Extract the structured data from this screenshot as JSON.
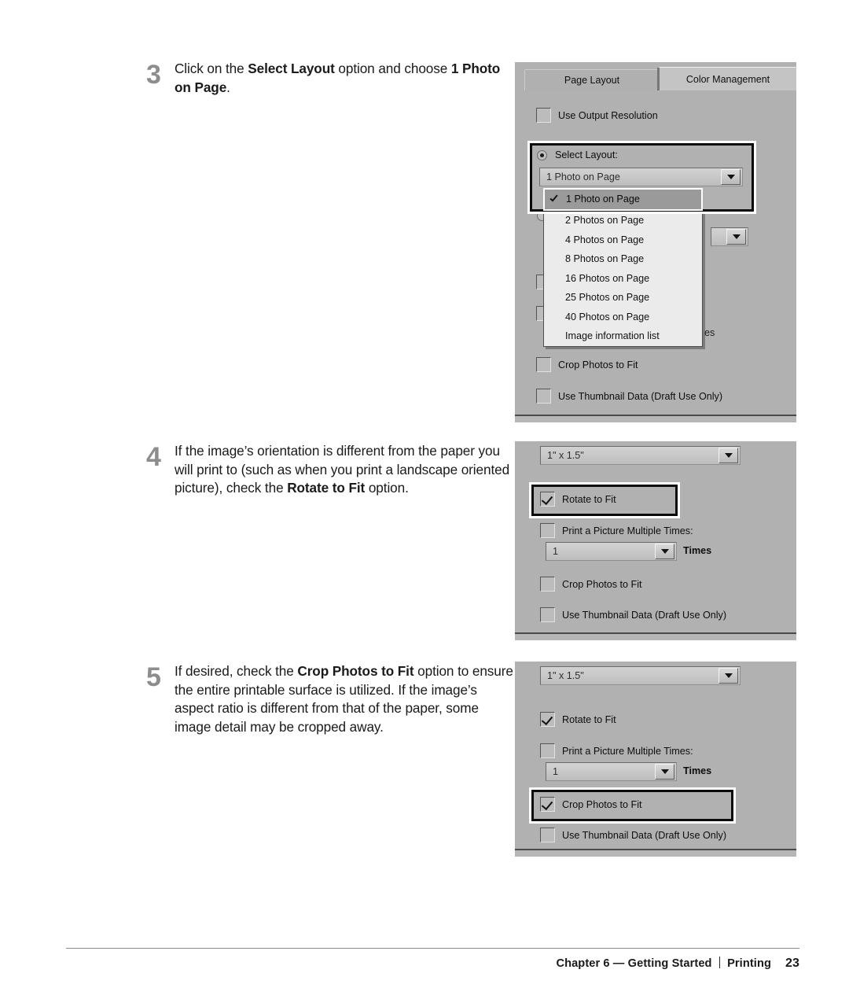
{
  "steps": [
    {
      "number": "3",
      "text_parts": [
        {
          "t": "Click on the ",
          "b": false
        },
        {
          "t": "Select Layout",
          "b": true
        },
        {
          "t": " option and choose ",
          "b": false
        },
        {
          "t": "1 Photo on Page",
          "b": true
        },
        {
          "t": ".",
          "b": false
        }
      ]
    },
    {
      "number": "4",
      "text_parts": [
        {
          "t": "If the image’s orientation is different from the paper you will print to (such as when you print a landscape oriented picture), check the ",
          "b": false
        },
        {
          "t": "Rotate to Fit",
          "b": true
        },
        {
          "t": " option.",
          "b": false
        }
      ]
    },
    {
      "number": "5",
      "text_parts": [
        {
          "t": "If desired, check the ",
          "b": false
        },
        {
          "t": "Crop Photos to Fit",
          "b": true
        },
        {
          "t": " option to ensure the entire printable surface is utilized. If the image’s aspect ratio is different from that of the paper, some image detail may be cropped away.",
          "b": false
        }
      ]
    }
  ],
  "panel1": {
    "tabs": [
      {
        "label": "Page Layout",
        "active": false
      },
      {
        "label": "Color Management",
        "active": true
      }
    ],
    "use_output_resolution": {
      "label": "Use Output Resolution",
      "checked": false
    },
    "select_layout": {
      "label": "Select Layout:",
      "selected": true
    },
    "layout_combo_value": "1 Photo on Page",
    "dropdown_items": [
      "1 Photo on Page",
      "2 Photos on Page",
      "4 Photos on Page",
      "8 Photos on Page",
      "16 Photos on Page",
      "25 Photos on Page",
      "40 Photos on Page",
      "Image information list"
    ],
    "dropdown_selected_index": 0,
    "times_label_fragment": "es",
    "crop_photos_to_fit": {
      "label": "Crop Photos to Fit",
      "checked": false
    },
    "use_thumbnail_data": {
      "label": "Use Thumbnail Data (Draft Use Only)",
      "checked": false
    }
  },
  "panel2": {
    "size_combo_value": "1\" x 1.5\"",
    "rotate_to_fit": {
      "label": "Rotate to Fit",
      "checked": true,
      "highlighted": true
    },
    "print_multiple": {
      "label": "Print a Picture Multiple Times:",
      "checked": false
    },
    "times_combo_value": "1",
    "times_label": "Times",
    "crop_photos_to_fit": {
      "label": "Crop Photos to Fit",
      "checked": false,
      "highlighted": false
    },
    "use_thumbnail_data": {
      "label": "Use Thumbnail Data (Draft Use Only)",
      "checked": false
    }
  },
  "panel3": {
    "size_combo_value": "1\" x 1.5\"",
    "rotate_to_fit": {
      "label": "Rotate to Fit",
      "checked": true,
      "highlighted": false
    },
    "print_multiple": {
      "label": "Print a Picture Multiple Times:",
      "checked": false
    },
    "times_combo_value": "1",
    "times_label": "Times",
    "crop_photos_to_fit": {
      "label": "Crop Photos to Fit",
      "checked": true,
      "highlighted": true
    },
    "use_thumbnail_data": {
      "label": "Use Thumbnail Data (Draft Use Only)",
      "checked": false
    }
  },
  "footer": {
    "chapter": "Chapter 6 — Getting Started",
    "section": "Printing",
    "page_number": "23"
  },
  "colors": {
    "panel_bg": "#b1b1b1",
    "dropdown_bg": "#ebebeb",
    "dropdown_selected_bg": "#9a9a9a",
    "step_number": "#8d8d8d",
    "text": "#1a1a1a",
    "highlight_border": "#0b0b0b"
  }
}
